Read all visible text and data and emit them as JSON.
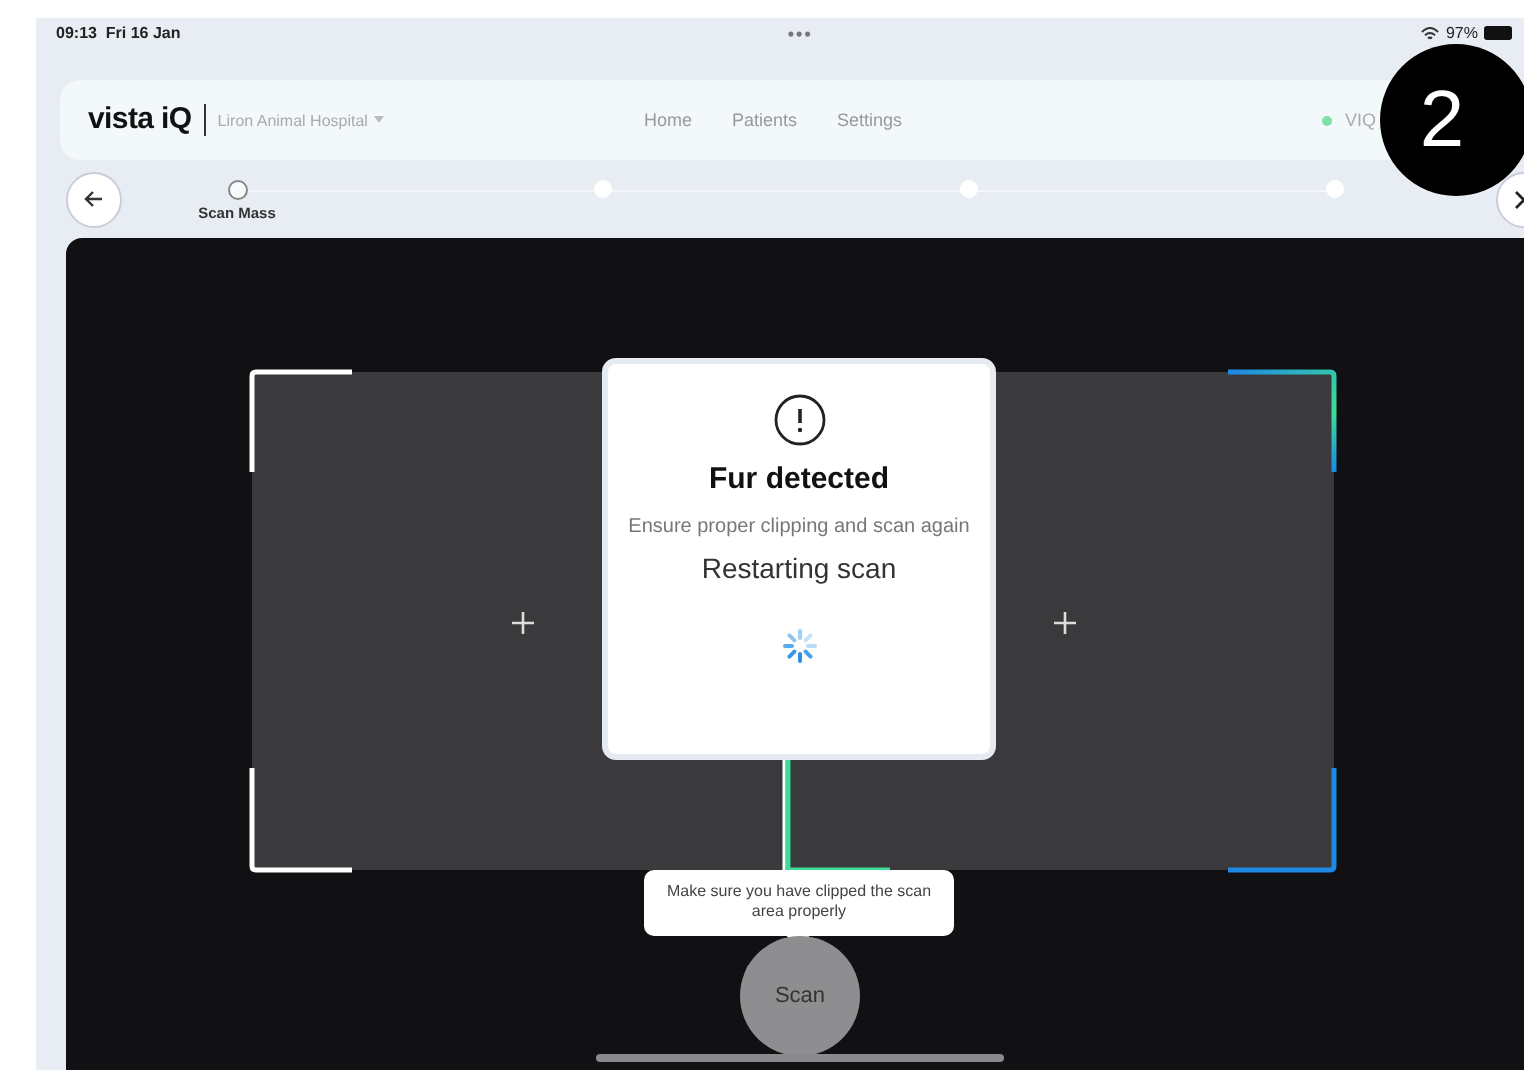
{
  "status_bar": {
    "time": "09:13",
    "date": "Fri 16 Jan",
    "dots": "•••",
    "battery": "97%"
  },
  "header": {
    "logo": "vista iQ",
    "clinic": "Liron Animal Hospital",
    "nav": [
      {
        "label": "Home"
      },
      {
        "label": "Patients"
      },
      {
        "label": "Settings"
      }
    ],
    "device": "VIQ",
    "connected": true
  },
  "steps": [
    {
      "label": "Scan Mass",
      "selected": true
    },
    {
      "selected": false
    },
    {
      "selected": false
    },
    {
      "selected": false
    }
  ],
  "dialog": {
    "title": "Fur detected",
    "message": "Ensure proper clipping and scan again",
    "status": "Restarting scan"
  },
  "tooltip": "Make sure you have clipped the scan area properly",
  "scan_button": "Scan",
  "badge": "2"
}
